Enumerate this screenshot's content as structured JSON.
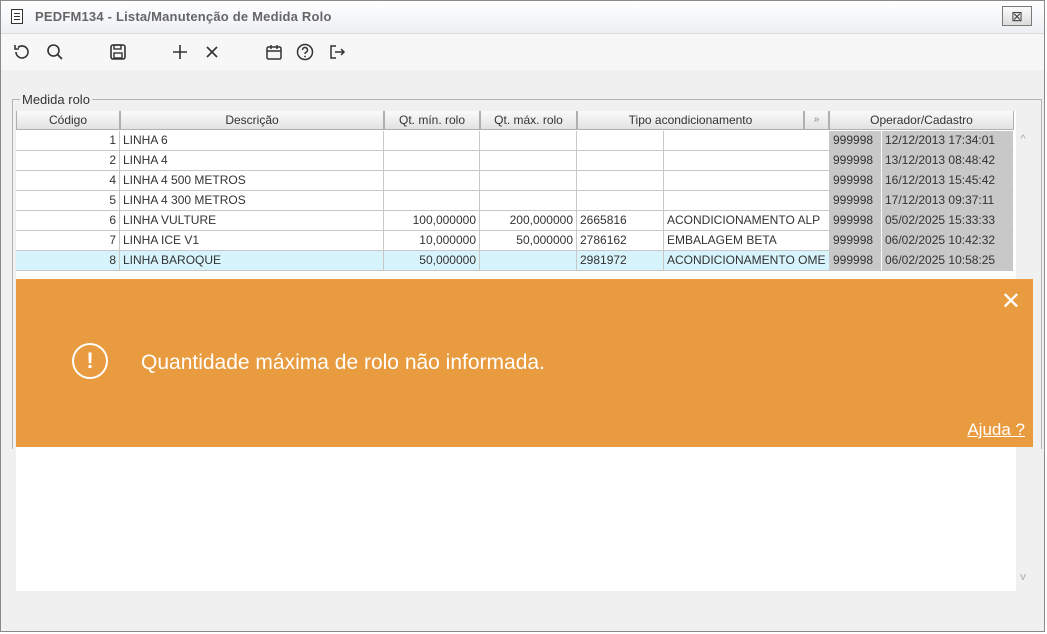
{
  "window": {
    "title": "PEDFM134 - Lista/Manutenção de Medida Rolo",
    "close_label": "⊠"
  },
  "toolbar": [
    "refresh-icon",
    "search-icon",
    "save-icon",
    "add-icon",
    "delete-icon",
    "calendar-icon",
    "help-icon",
    "exit-icon"
  ],
  "group": {
    "label": "Medida rolo"
  },
  "table": {
    "headers": [
      "Código",
      "Descrição",
      "Qt. mín. rolo",
      "Qt. máx. rolo",
      "Tipo acondicionamento",
      "»",
      "Operador/Cadastro"
    ],
    "rows": [
      [
        "1",
        "LINHA 6",
        "",
        "",
        "",
        "",
        "999998",
        "12/12/2013 17:34:01"
      ],
      [
        "2",
        "LINHA 4",
        "",
        "",
        "",
        "",
        "999998",
        "13/12/2013 08:48:42"
      ],
      [
        "4",
        "LINHA 4 500 METROS",
        "",
        "",
        "",
        "",
        "999998",
        "16/12/2013 15:45:42"
      ],
      [
        "5",
        "LINHA 4 300 METROS",
        "",
        "",
        "",
        "",
        "999998",
        "17/12/2013 09:37:11"
      ],
      [
        "6",
        "LINHA VULTURE",
        "100,000000",
        "200,000000",
        "2665816",
        "ACONDICIONAMENTO ALP",
        "999998",
        "05/02/2025 15:33:33"
      ],
      [
        "7",
        "LINHA ICE V1",
        "10,000000",
        "50,000000",
        "2786162",
        "EMBALAGEM BETA",
        "999998",
        "06/02/2025 10:42:32"
      ],
      [
        "8",
        "LINHA BAROQUE",
        "50,000000",
        "",
        "2981972",
        "ACONDICIONAMENTO OME",
        "999998",
        "06/02/2025 10:58:25"
      ]
    ],
    "selected_row": 6
  },
  "toast": {
    "message": "Quantidade máxima de rolo não informada.",
    "help": "Ajuda ?",
    "close": "✕",
    "icon": "!",
    "color": "#e99b3f"
  }
}
